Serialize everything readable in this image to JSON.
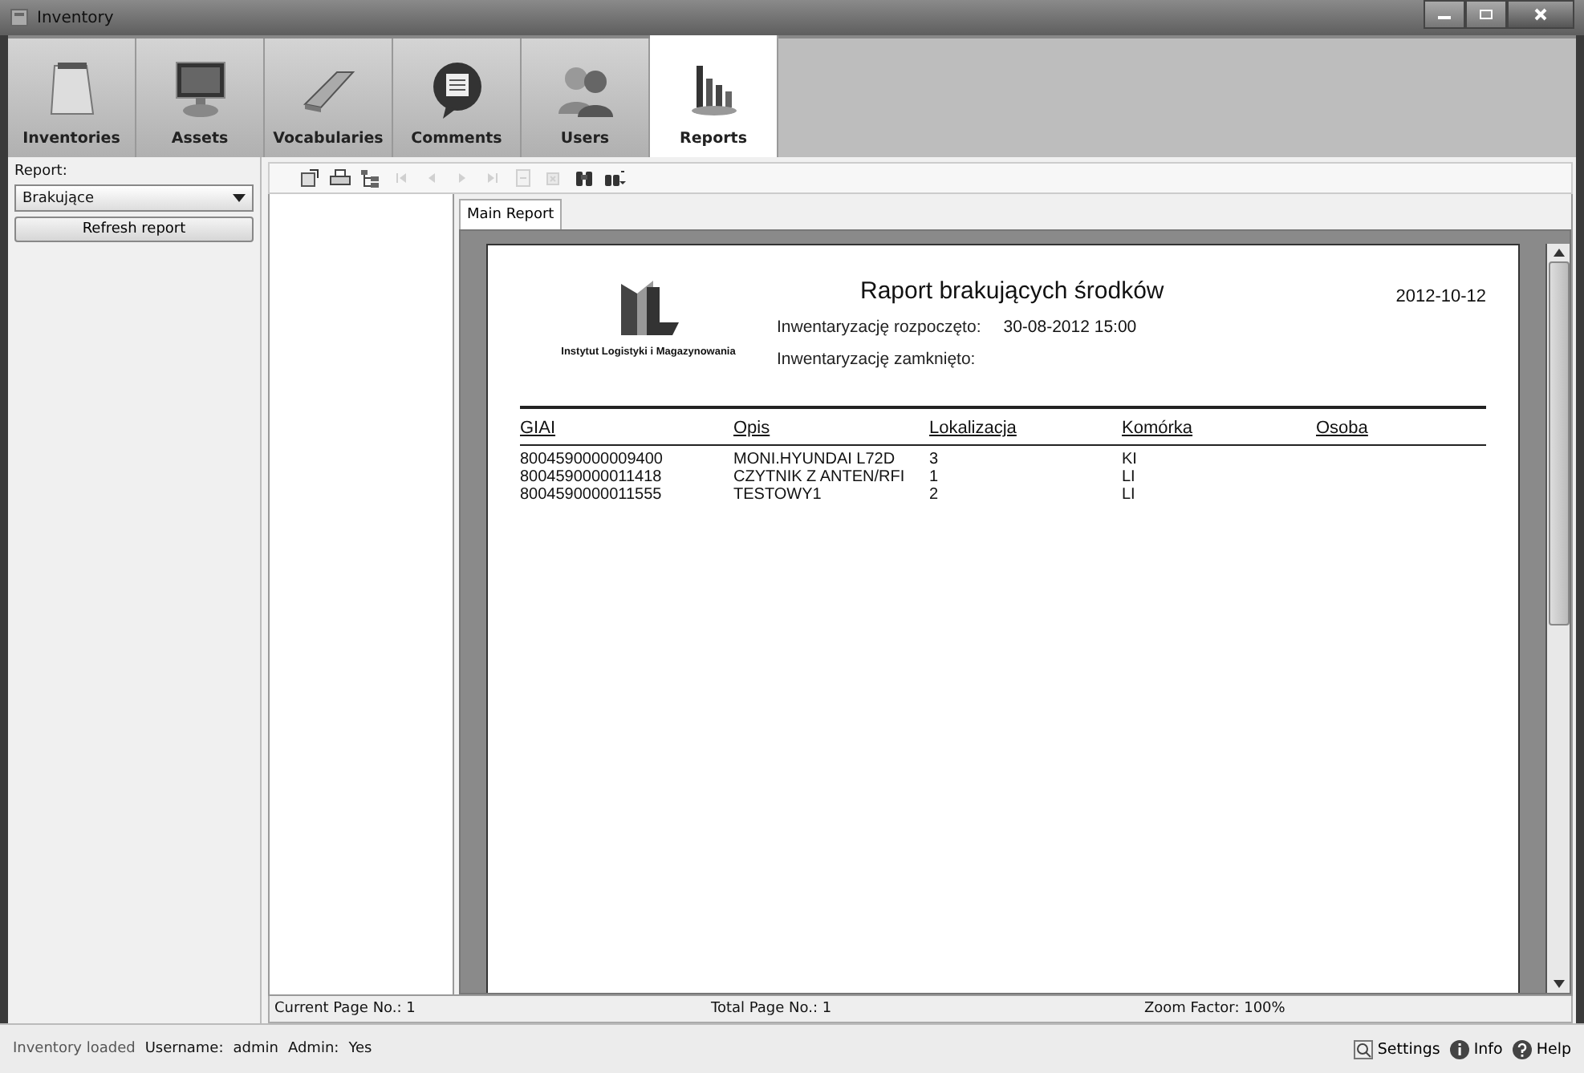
{
  "window": {
    "title": "Inventory"
  },
  "tabs": [
    {
      "label": "Inventories",
      "kind": "calendar",
      "selected": false
    },
    {
      "label": "Assets",
      "kind": "monitor",
      "selected": false
    },
    {
      "label": "Vocabularies",
      "kind": "book",
      "selected": false
    },
    {
      "label": "Comments",
      "kind": "bubble",
      "selected": false
    },
    {
      "label": "Users",
      "kind": "users",
      "selected": false
    },
    {
      "label": "Reports",
      "kind": "chart",
      "selected": true
    }
  ],
  "sidebar": {
    "report_label": "Report:",
    "report_value": "Brakujące",
    "refresh_button": "Refresh report"
  },
  "toolbar": [
    {
      "kind": "export",
      "disabled": false
    },
    {
      "kind": "print",
      "disabled": false
    },
    {
      "kind": "tree",
      "disabled": false
    },
    {
      "kind": "first",
      "disabled": true
    },
    {
      "kind": "prev",
      "disabled": true
    },
    {
      "kind": "next",
      "disabled": true
    },
    {
      "kind": "last",
      "disabled": true
    },
    {
      "kind": "goto",
      "disabled": true
    },
    {
      "kind": "stop",
      "disabled": true
    },
    {
      "kind": "find",
      "disabled": false
    },
    {
      "kind": "zoom",
      "disabled": false
    }
  ],
  "report_tab": "Main Report",
  "report": {
    "logo_caption": "Instytut Logistyki i Magazynowania",
    "title": "Raport brakujących środków",
    "date": "2012-10-12",
    "meta": [
      {
        "label": "Inwentaryzację rozpoczęto:",
        "value": "30-08-2012 15:00"
      },
      {
        "label": "Inwentaryzację zamknięto:"
      }
    ],
    "columns": [
      "GIAI",
      "Opis",
      "Lokalizacja",
      "Komórka",
      "Osoba"
    ],
    "rows": [
      [
        "8004590000009400",
        "MONI.HYUNDAI L72D",
        "3",
        "KI"
      ],
      [
        "8004590000011418",
        "CZYTNIK Z ANTEN/RFI",
        "1",
        "LI"
      ],
      [
        "8004590000011555",
        "TESTOWY1",
        "2",
        "LI"
      ]
    ]
  },
  "viewer_status": [
    "Current Page No.: 1",
    "Total Page No.: 1",
    "Zoom Factor: 100%"
  ],
  "status_bar": {
    "loaded": "Inventory loaded",
    "username_label": "Username:",
    "username": "admin",
    "admin_label": "Admin:",
    "admin": "Yes",
    "links": [
      {
        "kind": "settings",
        "label": "Settings"
      },
      {
        "kind": "info",
        "label": "Info"
      },
      {
        "kind": "help",
        "label": "Help"
      }
    ]
  }
}
